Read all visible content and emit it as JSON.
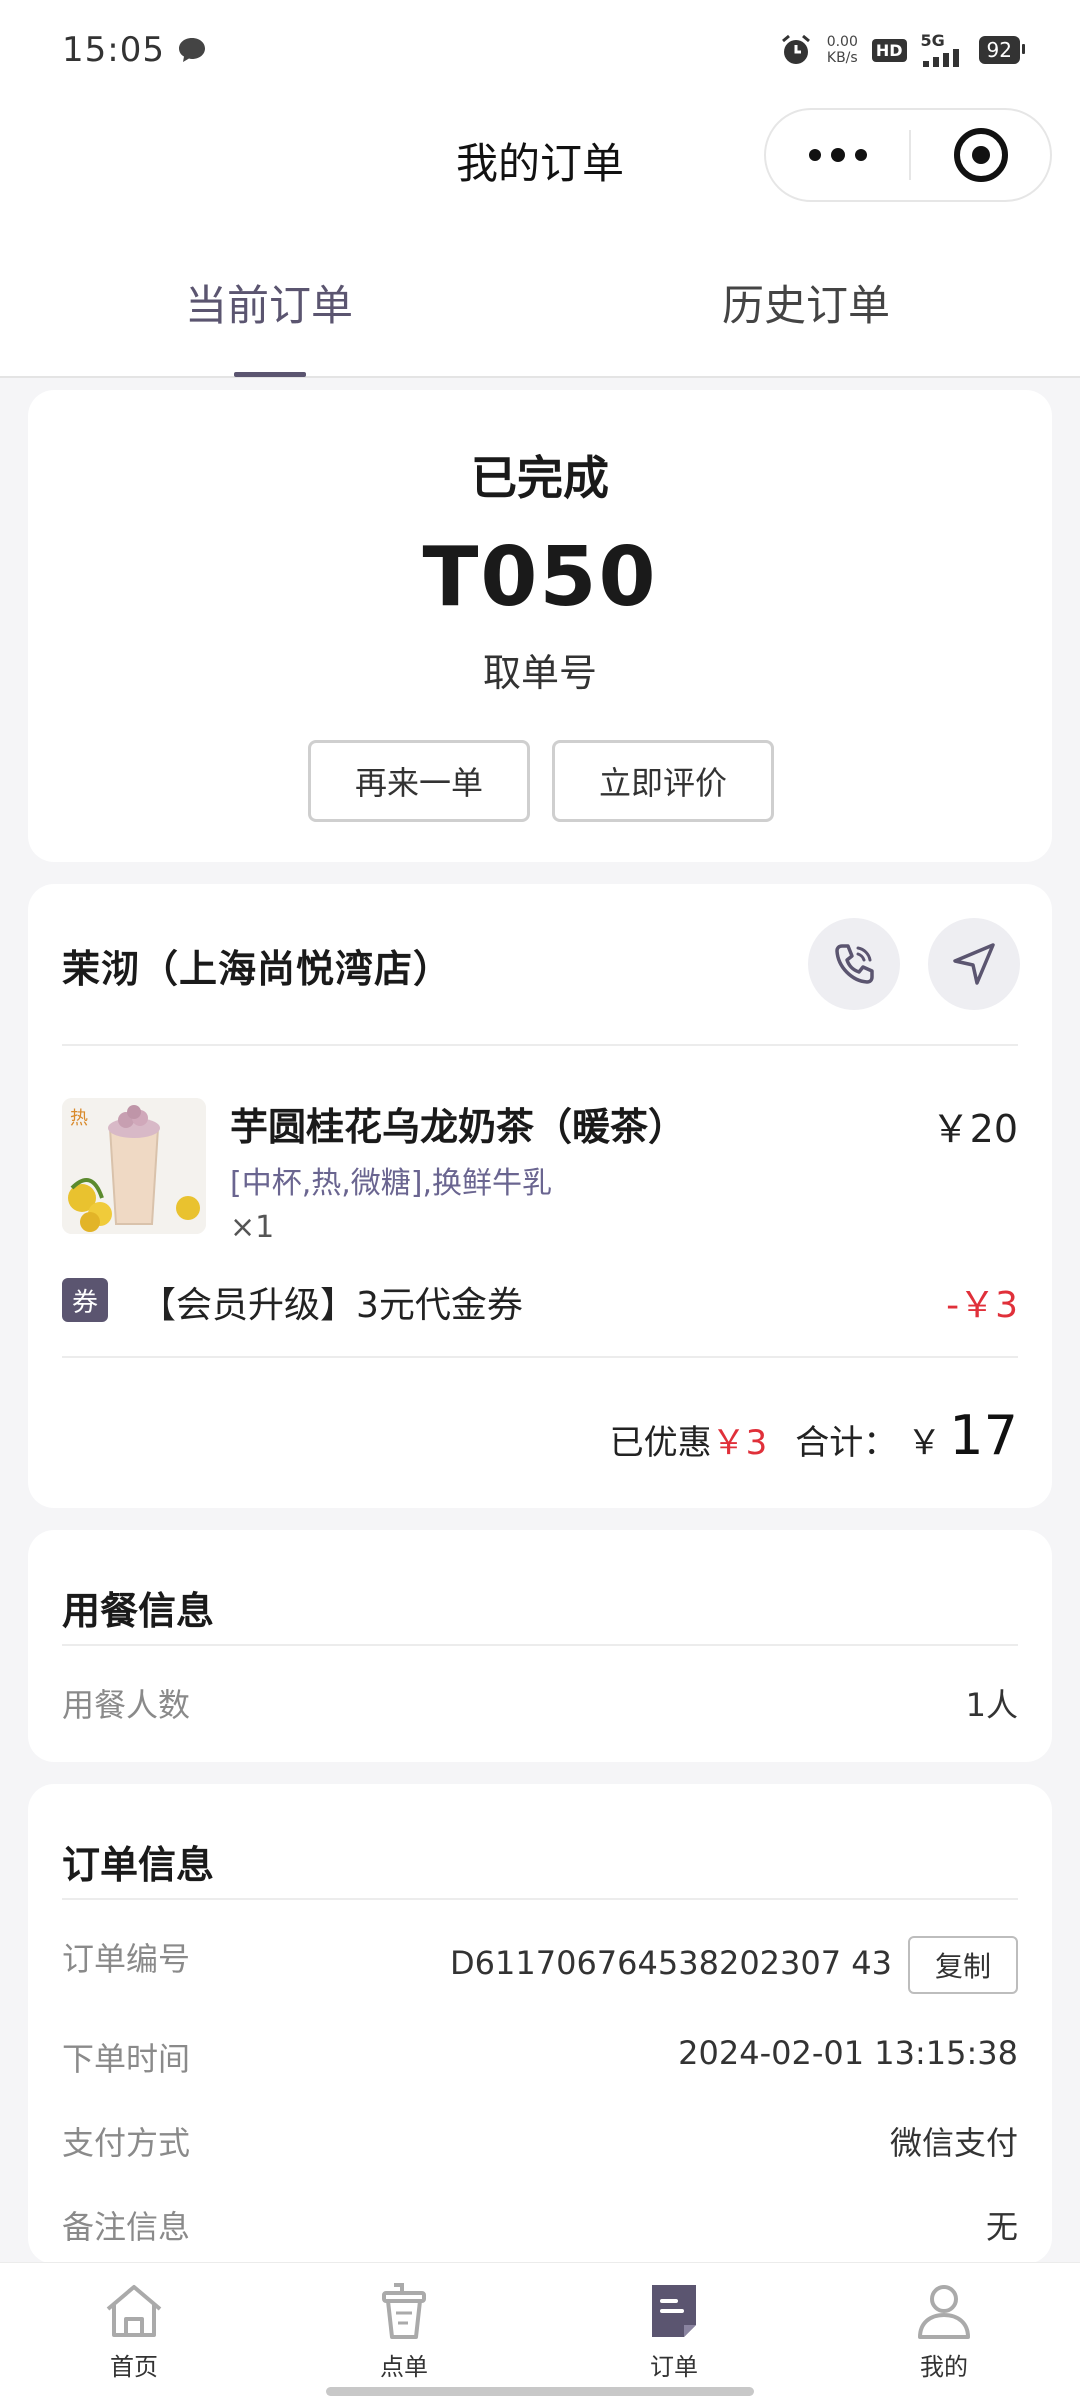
{
  "status_bar": {
    "time": "15:05",
    "net_speed_value": "0.00",
    "net_speed_unit": "KB/s",
    "hd": "HD",
    "network": "5G",
    "battery": "92"
  },
  "nav": {
    "title": "我的订单"
  },
  "tabs": {
    "current": "当前订单",
    "history": "历史订单"
  },
  "order_status": {
    "status": "已完成",
    "pickup_number": "T050",
    "pickup_label": "取单号",
    "reorder_label": "再来一单",
    "review_label": "立即评价"
  },
  "order_detail": {
    "store_name": "茉沏（上海尚悦湾店）",
    "product": {
      "badge": "热",
      "name": "芋圆桂花乌龙奶茶（暖茶）",
      "price": "￥20",
      "spec": "[中杯,热,微糖],换鲜牛乳",
      "qty": "×1"
    },
    "coupon": {
      "badge": "券",
      "name": "【会员升级】3元代金券",
      "amount": "-￥3"
    },
    "discount_label": "已优惠",
    "discount_value": "￥3",
    "total_label": "合计：",
    "total_currency": "￥",
    "total_value": "17"
  },
  "dining": {
    "title": "用餐信息",
    "diners_label": "用餐人数",
    "diners_value": "1人"
  },
  "order_info": {
    "title": "订单信息",
    "number_label": "订单编号",
    "number_value": "D611706764538202307 43",
    "copy_label": "复制",
    "time_label": "下单时间",
    "time_value": "2024-02-01 13:15:38",
    "payment_label": "支付方式",
    "payment_value": "微信支付",
    "remark_label": "备注信息",
    "remark_value": "无"
  },
  "tab_bar": {
    "home": "首页",
    "menu": "点单",
    "orders": "订单",
    "mine": "我的"
  },
  "colors": {
    "accent": "#5b5570",
    "price_red": "#e0303a",
    "background": "#f5f5f7"
  }
}
